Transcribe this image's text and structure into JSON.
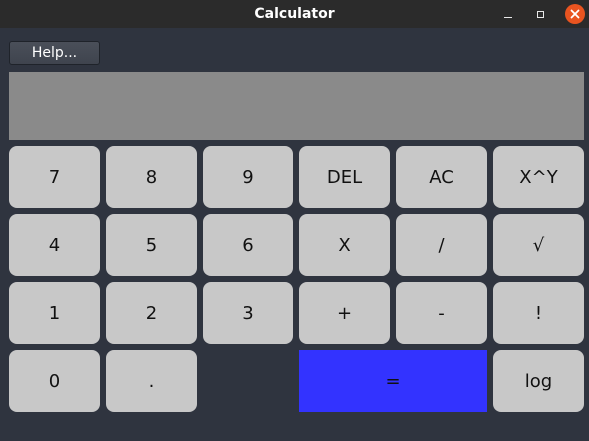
{
  "window": {
    "title": "Calculator"
  },
  "toolbar": {
    "help_label": "Help..."
  },
  "display": {
    "value": ""
  },
  "keypad": {
    "row1": [
      "7",
      "8",
      "9",
      "DEL",
      "AC",
      "X^Y"
    ],
    "row2": [
      "4",
      "5",
      "6",
      "X",
      "/",
      "√"
    ],
    "row3": [
      "1",
      "2",
      "3",
      "+",
      "-",
      "!"
    ],
    "row4": [
      "0",
      ".",
      "=",
      "log"
    ]
  },
  "colors": {
    "background": "#2f343f",
    "titlebar": "#2b2b2b",
    "display": "#8a8a8a",
    "key": "#c8c8c8",
    "equals_key": "#3333ff",
    "close_button": "#e95420"
  },
  "icons": {
    "minimize": "minimize-icon",
    "maximize": "maximize-icon",
    "close": "close-icon"
  }
}
